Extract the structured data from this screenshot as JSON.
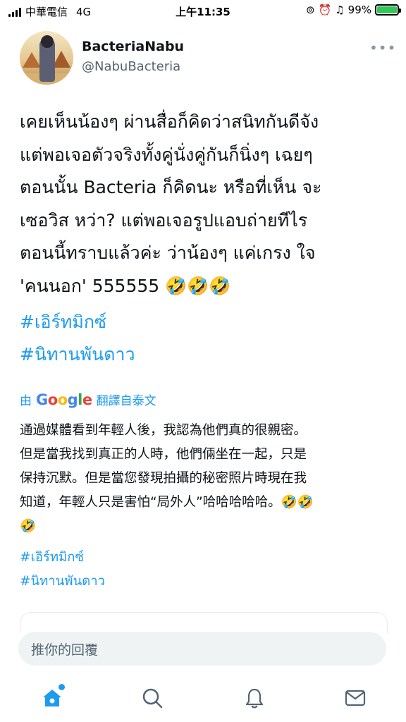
{
  "status_bar": {
    "carrier": "中華電信",
    "network": "4G",
    "time": "上午11:35",
    "battery": "99%"
  },
  "tweet": {
    "display_name": "BacteriaNabu",
    "handle": "@NabuBacteria",
    "more_icon": "more-icon",
    "body_lines": [
      "เคยเห็นน้องๆ ผ่านสื่อก็คิดว่าสนิทกันดีจัง",
      "แต่พอเจอตัวจริงทั้งคู่นั่งคู่กันก็นิ่งๆ เฉยๆ",
      "ตอนนั้น Bacteria ก็คิดนะ หรือที่เห็น จะ",
      "เซอวิส หว่า? แต่พอเจอรูปแอบถ่ายทีไร",
      "ตอนนี้ทราบแล้วค่ะ ว่าน้องๆ แค่เกรง ใจ",
      "'คนนอก' 555555 🤣🤣🤣"
    ],
    "hashtags": [
      "#เอิร์ทมิกซ์",
      "#นิทานพันดาว"
    ]
  },
  "translation": {
    "prefix": "由",
    "provider": "Google",
    "suffix": "翻譯自泰文",
    "lines": [
      "通過媒體看到年輕人後，我認為他們真的很親密。",
      "但是當我找到真正的人時，他們倆坐在一起，只是",
      "保持沉默。但是當您發現拍攝的秘密照片時現在我",
      "知道，年輕人只是害怕“局外人”哈哈哈哈哈。🤣🤣",
      "🤣"
    ],
    "hashtags": [
      "#เอิร์ทมิกซ์",
      "#นิทานพันดาว"
    ]
  },
  "reply": {
    "placeholder": "推你的回覆"
  },
  "tab_bar": {
    "items": [
      "home-icon",
      "search-icon",
      "notifications-icon",
      "messages-icon"
    ],
    "accent": "#1d9bf0"
  }
}
